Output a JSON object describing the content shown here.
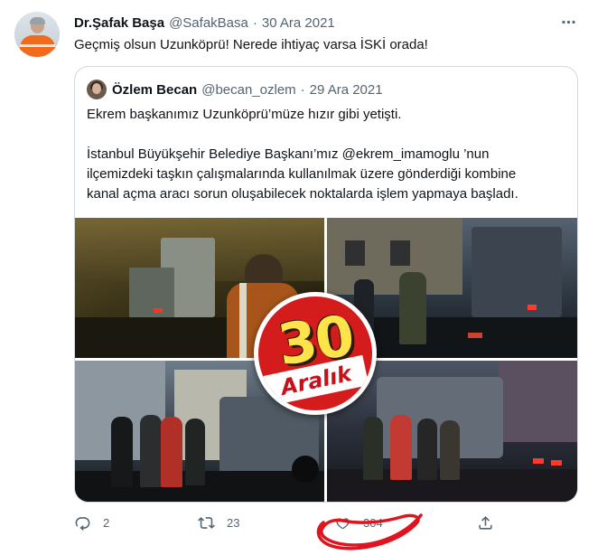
{
  "tweet": {
    "author_name": "Dr.Şafak Başa",
    "author_handle": "@SafakBasa",
    "separator": "·",
    "date": "30 Ara 2021",
    "more_icon": "more-horizontal-icon",
    "text": "Geçmiş olsun Uzunköprü! Nerede ihtiyaç varsa İSKİ orada!"
  },
  "quote": {
    "author_name": "Özlem Becan",
    "author_handle": "@becan_ozlem",
    "separator": "·",
    "date": "29 Ara 2021",
    "line1": "Ekrem başkanımız Uzunköprü’müze hızır gibi yetişti.",
    "line2": "İstanbul Büyükşehir Belediye Başkanı’mız @ekrem_imamoglu ’nun",
    "line3": "ilçemizdeki taşkın çalışmalarında kullanılmak üzere gönderdiği kombine",
    "line4": "kanal açma aracı sorun oluşabilecek noktalarda işlem yapmaya başladı."
  },
  "overlay_badge": {
    "number": "30",
    "word": "Aralık"
  },
  "actions": {
    "reply_count": "2",
    "retweet_count": "23",
    "like_count": "304",
    "share_count": ""
  },
  "colors": {
    "text_primary": "#0f1419",
    "text_secondary": "#536471",
    "border": "#cfd9de",
    "badge_red": "#d41c1c",
    "badge_yellow": "#ffe34a",
    "scribble_red": "#e0141e"
  }
}
